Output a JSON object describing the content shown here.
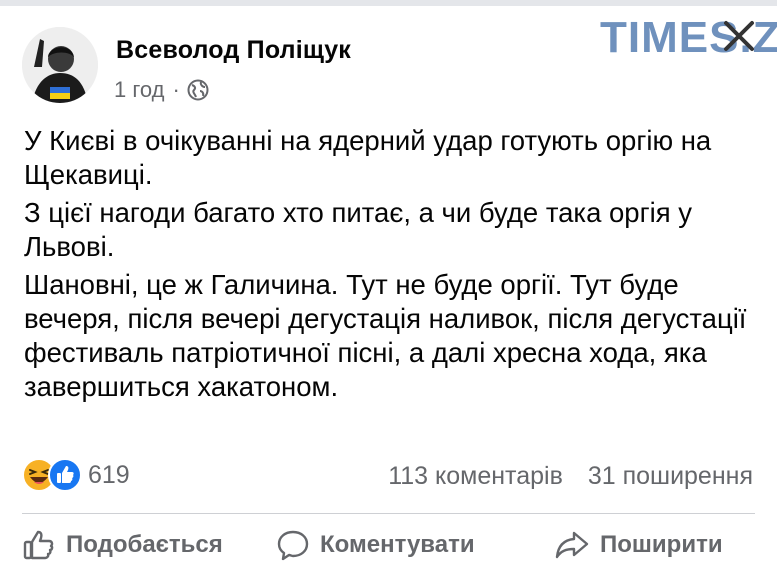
{
  "post": {
    "author": "Всеволод Поліщук",
    "time": "1 год",
    "separator": "·",
    "privacy_icon": "globe-icon",
    "paragraphs": [
      "У Києві в очікуванні на ядерний удар готують оргію на Щекавиці.",
      "З цієї нагоди багато хто питає, а чи буде така оргія у Львові.",
      "Шановні, це ж Галичина. Тут не буде оргії. Тут буде вечеря, після вечері дегустація наливок, після дегустації фестиваль патріотичної пісні, а далі хресна хода, яка завершиться хакатоном."
    ]
  },
  "watermark": {
    "text": "TIMES.ZT"
  },
  "reactions": {
    "icons": [
      "haha-icon",
      "like-icon"
    ],
    "count": "619"
  },
  "stats": {
    "comments": "113 коментарів",
    "shares": "31 поширення"
  },
  "actions": {
    "like": "Подобається",
    "comment": "Коментувати",
    "share": "Поширити"
  },
  "colors": {
    "text": "#050505",
    "muted": "#65676b",
    "like_blue": "#1877f2",
    "haha_yellow": "#f7b125",
    "watermark": "#6f91bd"
  }
}
